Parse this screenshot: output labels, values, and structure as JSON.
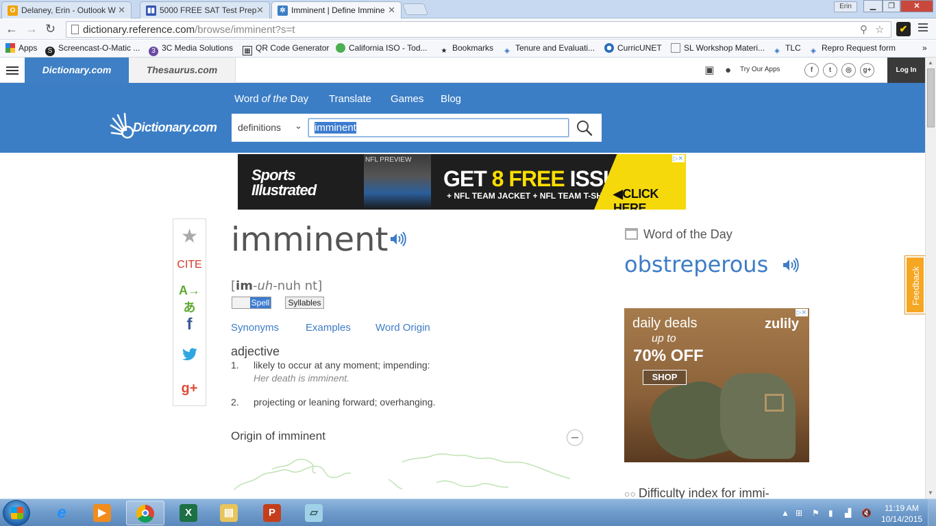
{
  "browser": {
    "tabs": [
      {
        "title": "Delaney, Erin - Outlook W",
        "icon": "outlook-icon",
        "color": "#f0a30a"
      },
      {
        "title": "5000 FREE SAT Test Prep",
        "icon": "bars-icon",
        "color": "#3455b0"
      },
      {
        "title": "Imminent | Define Immine",
        "icon": "dictionary-icon",
        "color": "#3c7ec6"
      }
    ],
    "user_badge": "Erin",
    "url_host": "dictionary.reference.com",
    "url_path": "/browse/imminent?s=t",
    "bookmarks": [
      "Apps",
      "Screencast-O-Matic ...",
      "3C Media Solutions",
      "QR Code Generator",
      "California ISO - Tod...",
      "Bookmarks",
      "Tenure and Evaluati...",
      "CurricUNET",
      "SL Workshop Materi...",
      "TLC",
      "Repro Request form"
    ],
    "bookmarks_more": "»"
  },
  "site": {
    "tab_dictionary": "Dictionary.com",
    "tab_thesaurus": "Thesaurus.com",
    "try_apps": "Try Our Apps",
    "login": "Log In",
    "nav": {
      "wotd_word": "Word",
      "wotd_of": "of the",
      "wotd_day": "Day",
      "translate": "Translate",
      "games": "Games",
      "blog": "Blog"
    },
    "logo_text": "Dictionary.com",
    "search": {
      "select_value": "definitions",
      "input_value": "imminent"
    }
  },
  "ad_top": {
    "brand": "Sports Illustrated",
    "cover_label": "NFL PREVIEW",
    "headline_pre": "GET ",
    "headline_hl": "8 FREE",
    "headline_post": " ISSUES",
    "sub": "+ NFL TEAM JACKET + NFL TEAM T-SHIRT",
    "cta": "CLICK HERE"
  },
  "share": {
    "cite": "CITE"
  },
  "entry": {
    "headword": "imminent",
    "pron_open": "[",
    "pron_stress": "im",
    "pron_sep": "-",
    "pron_mid": "uh",
    "pron_rest": "-nuh nt]",
    "spell_label": "Spell",
    "syllables_label": "Syllables",
    "tabs": [
      "Synonyms",
      "Examples",
      "Word Origin"
    ],
    "part_of_speech": "adjective",
    "definitions": [
      {
        "num": "1.",
        "text": "likely to occur at any moment; impending:",
        "example": "Her death is imminent."
      },
      {
        "num": "2.",
        "text": "projecting or leaning forward; overhanging.",
        "example": ""
      }
    ],
    "origin_title": "Origin of imminent"
  },
  "sidebar": {
    "wotd_label": "Word of the Day",
    "wotd_word": "obstreperous",
    "difficulty": "Difficulty index for immi-"
  },
  "ad_right": {
    "line1": "daily deals",
    "line2": "up to",
    "line3": "70% OFF",
    "cta": "SHOP",
    "brand": "zulily"
  },
  "feedback": "Feedback",
  "taskbar": {
    "time": "11:19 AM",
    "date": "10/14/2015"
  }
}
